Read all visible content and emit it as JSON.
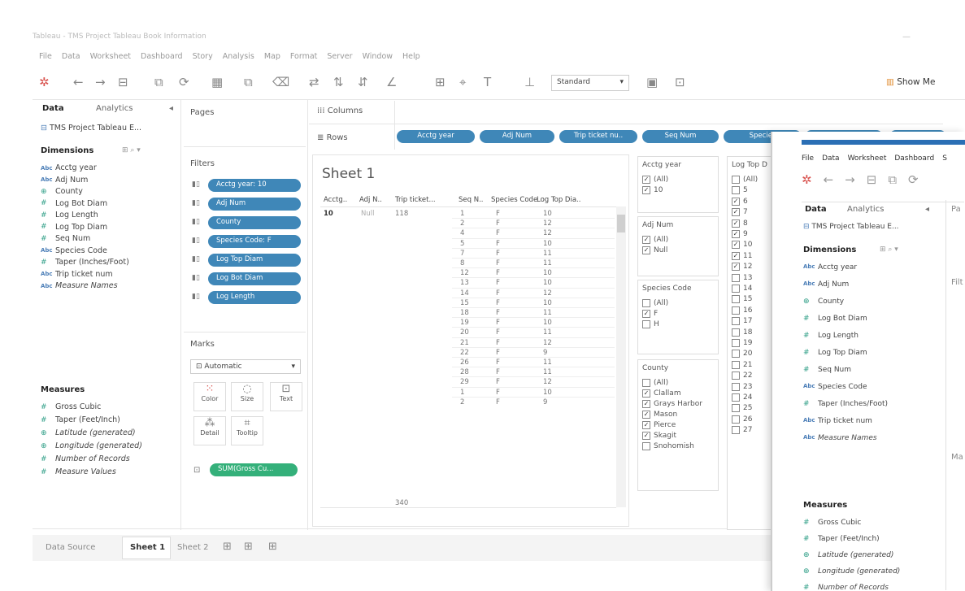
{
  "window": {
    "title": "Tableau - TMS Project Tableau Book Information"
  },
  "menu": [
    "File",
    "Data",
    "Worksheet",
    "Dashboard",
    "Story",
    "Analysis",
    "Map",
    "Format",
    "Server",
    "Window",
    "Help"
  ],
  "toolbar": {
    "fit": "Standard",
    "show_me": "Show Me"
  },
  "data_pane": {
    "tab_data": "Data",
    "tab_analytics": "Analytics",
    "source": "TMS Project Tableau E...",
    "dimensions_header": "Dimensions",
    "dimensions": [
      "Acctg year",
      "Adj Num",
      "County",
      "Log Bot Diam",
      "Log Length",
      "Log Top Diam",
      "Seq Num",
      "Species Code",
      "Taper (Inches/Foot)",
      "Trip ticket num",
      "Measure Names"
    ],
    "measures_header": "Measures",
    "measures": [
      "Gross Cubic",
      "Taper (Feet/Inch)",
      "Latitude (generated)",
      "Longitude (generated)",
      "Number of Records",
      "Measure Values"
    ]
  },
  "pages": {
    "label": "Pages"
  },
  "filters": {
    "label": "Filters",
    "items": [
      "Acctg year: 10",
      "Adj Num",
      "County",
      "Species Code: F",
      "Log Top Diam",
      "Log Bot Diam",
      "Log Length"
    ]
  },
  "marks": {
    "label": "Marks",
    "type": "Automatic",
    "buttons": [
      "Color",
      "Size",
      "Text",
      "Detail",
      "Tooltip"
    ],
    "pill": "SUM(Gross Cu..."
  },
  "shelves": {
    "columns": "Columns",
    "rows": "Rows",
    "row_pills": [
      "Acctg year",
      "Adj Num",
      "Trip ticket nu..",
      "Seq Num",
      "Species"
    ]
  },
  "sheet": {
    "title": "Sheet 1",
    "headers": [
      "Acctg..",
      "Adj N..",
      "Trip ticket...",
      "Seq N..",
      "Species Code",
      "Log Top Dia.."
    ],
    "acctg": "10",
    "adj": "Null",
    "trip1": "118",
    "trip2": "340",
    "seq": [
      "1",
      "2",
      "4",
      "5",
      "7",
      "8",
      "12",
      "13",
      "14",
      "15",
      "18",
      "19",
      "20",
      "21",
      "22",
      "26",
      "28",
      "29",
      "1",
      "2"
    ],
    "species": [
      "F",
      "F",
      "F",
      "F",
      "F",
      "F",
      "F",
      "F",
      "F",
      "F",
      "F",
      "F",
      "F",
      "F",
      "F",
      "F",
      "F",
      "F",
      "F",
      "F"
    ],
    "top": [
      "10",
      "12",
      "12",
      "10",
      "11",
      "11",
      "10",
      "10",
      "12",
      "10",
      "11",
      "10",
      "11",
      "12",
      "9",
      "11",
      "11",
      "12",
      "10",
      "9"
    ]
  },
  "cards": {
    "acctg": {
      "title": "Acctg year",
      "items": [
        {
          "label": "(All)",
          "checked": true
        },
        {
          "label": "10",
          "checked": true
        }
      ]
    },
    "adj": {
      "title": "Adj Num",
      "items": [
        {
          "label": "(All)",
          "checked": true
        },
        {
          "label": "Null",
          "checked": true
        }
      ]
    },
    "species": {
      "title": "Species Code",
      "items": [
        {
          "label": "(All)",
          "checked": false
        },
        {
          "label": "F",
          "checked": true
        },
        {
          "label": "H",
          "checked": false
        }
      ]
    },
    "county": {
      "title": "County",
      "items": [
        {
          "label": "(All)",
          "checked": false
        },
        {
          "label": "Clallam",
          "checked": true
        },
        {
          "label": "Grays Harbor",
          "checked": true
        },
        {
          "label": "Mason",
          "checked": true
        },
        {
          "label": "Pierce",
          "checked": true
        },
        {
          "label": "Skagit",
          "checked": true
        },
        {
          "label": "Snohomish",
          "checked": false
        }
      ]
    },
    "logtop": {
      "title": "Log Top D",
      "items": [
        "(All)",
        "5",
        "6",
        "7",
        "8",
        "9",
        "10",
        "11",
        "12",
        "13",
        "14",
        "15",
        "16",
        "17",
        "18",
        "19",
        "20",
        "21",
        "22",
        "23",
        "24",
        "25",
        "26",
        "27"
      ],
      "checked": [
        "6",
        "7",
        "8",
        "9",
        "10",
        "11",
        "12"
      ]
    }
  },
  "tabs": {
    "data_source": "Data Source",
    "sheet1": "Sheet 1",
    "sheet2": "Sheet 2"
  },
  "overlay": {
    "menu": [
      "File",
      "Data",
      "Worksheet",
      "Dashboard",
      "S"
    ],
    "tab_data": "Data",
    "tab_analytics": "Analytics",
    "source": "TMS Project Tableau E...",
    "dimensions_header": "Dimensions",
    "measures_header": "Measures",
    "pages_short": "Pa",
    "filters_short": "Filt",
    "marks_short": "Ma"
  }
}
